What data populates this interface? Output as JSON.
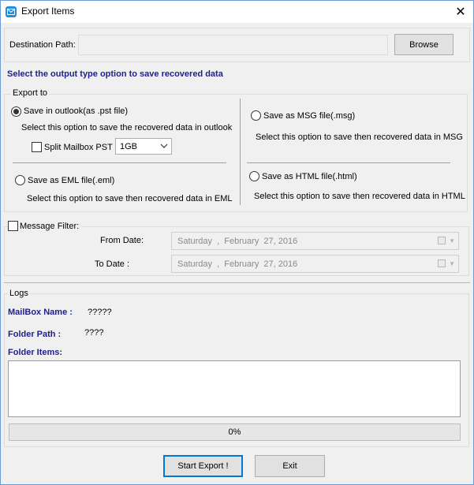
{
  "window": {
    "title": "Export Items"
  },
  "destination": {
    "label": "Destination Path:",
    "value": "",
    "browse_label": "Browse"
  },
  "instruction": "Select the output type option to save recovered data",
  "export_to": {
    "group_label": "Export to",
    "pst": {
      "label": "Save in outlook(as .pst file)",
      "desc": "Select this option to save the recovered data in outlook",
      "checked": true
    },
    "split": {
      "label": "Split Mailbox PST",
      "size_value": "1GB"
    },
    "eml": {
      "label": "Save as EML file(.eml)",
      "desc": "Select this option to save then recovered data in EML"
    },
    "msg": {
      "label": "Save as MSG file(.msg)",
      "desc": "Select this option to save then recovered data in MSG"
    },
    "html": {
      "label": "Save as HTML file(.html)",
      "desc": "Select this option to save then recovered data in HTML"
    }
  },
  "filter": {
    "label": "Message Filter:",
    "from_label": "From Date:",
    "from_value": "Saturday  ,  February  27, 2016",
    "to_label": "To Date :",
    "to_value": "Saturday  ,  February  27, 2016"
  },
  "logs": {
    "group_label": "Logs",
    "mailbox_label": "MailBox Name :",
    "mailbox_value": "?????",
    "folder_path_label": "Folder Path :",
    "folder_path_value": "????",
    "folder_items_label": "Folder Items:",
    "progress_text": "0%",
    "progress_value": 0
  },
  "actions": {
    "start_label": "Start Export !",
    "exit_label": "Exit"
  },
  "colors": {
    "accent": "#0078d7",
    "heading": "#1f1f8c",
    "window_bg": "#f0f0f0",
    "title_icon": "#1c8fe0"
  },
  "icons": {
    "app": "mail-envelope-icon",
    "close": "close-icon",
    "dropdown": "chevron-down-icon",
    "calendar": "calendar-icon"
  }
}
